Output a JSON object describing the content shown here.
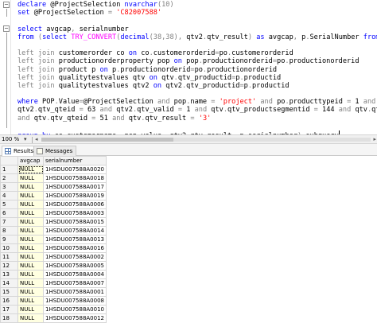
{
  "editor": {
    "lines": [
      [
        {
          "t": "declare ",
          "c": "kw"
        },
        {
          "t": "@ProjectSelection ",
          "c": "vr"
        },
        {
          "t": "nvarchar",
          "c": "kw"
        },
        {
          "t": "(10)",
          "c": "op"
        }
      ],
      [
        {
          "t": "set ",
          "c": "kw"
        },
        {
          "t": "@ProjectSelection ",
          "c": "vr"
        },
        {
          "t": "= ",
          "c": "op"
        },
        {
          "t": "'C82007588'",
          "c": "str"
        }
      ],
      [],
      [
        {
          "t": "select ",
          "c": "kw"
        },
        {
          "t": "avgcap",
          "c": "vr"
        },
        {
          "t": ", ",
          "c": "op"
        },
        {
          "t": "serialnumber",
          "c": "vr"
        }
      ],
      [
        {
          "t": "from ",
          "c": "kw"
        },
        {
          "t": "(",
          "c": "op"
        },
        {
          "t": "select ",
          "c": "kw"
        },
        {
          "t": "TRY_CONVERT",
          "c": "fn"
        },
        {
          "t": "(",
          "c": "op"
        },
        {
          "t": "decimal",
          "c": "kw"
        },
        {
          "t": "(38,38), ",
          "c": "op"
        },
        {
          "t": "qtv2",
          "c": "vr"
        },
        {
          "t": ".",
          "c": "op"
        },
        {
          "t": "qtv_result",
          "c": "vr"
        },
        {
          "t": ") ",
          "c": "op"
        },
        {
          "t": "as ",
          "c": "kw"
        },
        {
          "t": "avgcap",
          "c": "vr"
        },
        {
          "t": ", ",
          "c": "op"
        },
        {
          "t": "p",
          "c": "vr"
        },
        {
          "t": ".",
          "c": "op"
        },
        {
          "t": "SerialNumber ",
          "c": "vr"
        },
        {
          "t": "from ",
          "c": "kw"
        },
        {
          "t": "ProductionOrder PO",
          "c": "vr"
        }
      ],
      [],
      [
        {
          "t": "left join ",
          "c": "op"
        },
        {
          "t": "customerorder co ",
          "c": "vr"
        },
        {
          "t": "on ",
          "c": "kw"
        },
        {
          "t": "co",
          "c": "vr"
        },
        {
          "t": ".",
          "c": "op"
        },
        {
          "t": "customerorderid",
          "c": "vr"
        },
        {
          "t": "=",
          "c": "op"
        },
        {
          "t": "po",
          "c": "vr"
        },
        {
          "t": ".",
          "c": "op"
        },
        {
          "t": "customerorderid",
          "c": "vr"
        }
      ],
      [
        {
          "t": "left join ",
          "c": "op"
        },
        {
          "t": "productionorderproperty pop ",
          "c": "vr"
        },
        {
          "t": "on ",
          "c": "kw"
        },
        {
          "t": "pop",
          "c": "vr"
        },
        {
          "t": ".",
          "c": "op"
        },
        {
          "t": "productionorderid",
          "c": "vr"
        },
        {
          "t": "=",
          "c": "op"
        },
        {
          "t": "po",
          "c": "vr"
        },
        {
          "t": ".",
          "c": "op"
        },
        {
          "t": "productionorderid",
          "c": "vr"
        }
      ],
      [
        {
          "t": "left join ",
          "c": "op"
        },
        {
          "t": "product p ",
          "c": "vr"
        },
        {
          "t": "on ",
          "c": "kw"
        },
        {
          "t": "p",
          "c": "vr"
        },
        {
          "t": ".",
          "c": "op"
        },
        {
          "t": "productionorderid",
          "c": "vr"
        },
        {
          "t": "=",
          "c": "op"
        },
        {
          "t": "po",
          "c": "vr"
        },
        {
          "t": ".",
          "c": "op"
        },
        {
          "t": "productionorderid",
          "c": "vr"
        }
      ],
      [
        {
          "t": "left join ",
          "c": "op"
        },
        {
          "t": "qualitytestvalues qtv ",
          "c": "vr"
        },
        {
          "t": "on ",
          "c": "kw"
        },
        {
          "t": "qtv",
          "c": "vr"
        },
        {
          "t": ".",
          "c": "op"
        },
        {
          "t": "qtv_productid",
          "c": "vr"
        },
        {
          "t": "=",
          "c": "op"
        },
        {
          "t": "p",
          "c": "vr"
        },
        {
          "t": ".",
          "c": "op"
        },
        {
          "t": "productid",
          "c": "vr"
        }
      ],
      [
        {
          "t": "left join ",
          "c": "op"
        },
        {
          "t": "qualitytestvalues qtv2 ",
          "c": "vr"
        },
        {
          "t": "on ",
          "c": "kw"
        },
        {
          "t": "qtv2",
          "c": "vr"
        },
        {
          "t": ".",
          "c": "op"
        },
        {
          "t": "qtv_productid",
          "c": "vr"
        },
        {
          "t": "=",
          "c": "op"
        },
        {
          "t": "p",
          "c": "vr"
        },
        {
          "t": ".",
          "c": "op"
        },
        {
          "t": "productid",
          "c": "vr"
        }
      ],
      [],
      [
        {
          "t": "where ",
          "c": "kw"
        },
        {
          "t": "POP",
          "c": "vr"
        },
        {
          "t": ".",
          "c": "op"
        },
        {
          "t": "Value",
          "c": "vr"
        },
        {
          "t": "=",
          "c": "op"
        },
        {
          "t": "@ProjectSelection ",
          "c": "vr"
        },
        {
          "t": "and ",
          "c": "op"
        },
        {
          "t": "pop",
          "c": "vr"
        },
        {
          "t": ".",
          "c": "op"
        },
        {
          "t": "name ",
          "c": "vr"
        },
        {
          "t": "= ",
          "c": "op"
        },
        {
          "t": "'project' ",
          "c": "str"
        },
        {
          "t": "and ",
          "c": "op"
        },
        {
          "t": "po",
          "c": "vr"
        },
        {
          "t": ".",
          "c": "op"
        },
        {
          "t": "producttypeid ",
          "c": "vr"
        },
        {
          "t": "= ",
          "c": "op"
        },
        {
          "t": "1 ",
          "c": "vr"
        },
        {
          "t": "and",
          "c": "op"
        }
      ],
      [
        {
          "t": "qtv2",
          "c": "vr"
        },
        {
          "t": ".",
          "c": "op"
        },
        {
          "t": "qtv_qteid ",
          "c": "vr"
        },
        {
          "t": "= ",
          "c": "op"
        },
        {
          "t": "63 ",
          "c": "vr"
        },
        {
          "t": "and ",
          "c": "op"
        },
        {
          "t": "qtv2",
          "c": "vr"
        },
        {
          "t": ".",
          "c": "op"
        },
        {
          "t": "qtv_valid ",
          "c": "vr"
        },
        {
          "t": "= ",
          "c": "op"
        },
        {
          "t": "1 ",
          "c": "vr"
        },
        {
          "t": "and ",
          "c": "op"
        },
        {
          "t": "qtv",
          "c": "vr"
        },
        {
          "t": ".",
          "c": "op"
        },
        {
          "t": "qtv_productsegmentid ",
          "c": "vr"
        },
        {
          "t": "= ",
          "c": "op"
        },
        {
          "t": "144 ",
          "c": "vr"
        },
        {
          "t": "and ",
          "c": "op"
        },
        {
          "t": "qtv",
          "c": "vr"
        },
        {
          "t": ".",
          "c": "op"
        },
        {
          "t": "qtv_valid ",
          "c": "vr"
        },
        {
          "t": "= ",
          "c": "op"
        },
        {
          "t": "1",
          "c": "vr"
        }
      ],
      [
        {
          "t": "and ",
          "c": "op"
        },
        {
          "t": "qtv",
          "c": "vr"
        },
        {
          "t": ".",
          "c": "op"
        },
        {
          "t": "qtv_qteid ",
          "c": "vr"
        },
        {
          "t": "= ",
          "c": "op"
        },
        {
          "t": "51 ",
          "c": "vr"
        },
        {
          "t": "and ",
          "c": "op"
        },
        {
          "t": "qtv",
          "c": "vr"
        },
        {
          "t": ".",
          "c": "op"
        },
        {
          "t": "qtv_result ",
          "c": "vr"
        },
        {
          "t": "= ",
          "c": "op"
        },
        {
          "t": "'3'",
          "c": "str"
        }
      ],
      [],
      [
        {
          "t": "group by ",
          "c": "kw"
        },
        {
          "t": "co",
          "c": "vr"
        },
        {
          "t": ".",
          "c": "op"
        },
        {
          "t": "customername",
          "c": "vr"
        },
        {
          "t": ", ",
          "c": "op"
        },
        {
          "t": "pop",
          "c": "vr"
        },
        {
          "t": ".",
          "c": "op"
        },
        {
          "t": "value",
          "c": "vr"
        },
        {
          "t": ", ",
          "c": "op"
        },
        {
          "t": "qtv2",
          "c": "vr"
        },
        {
          "t": ".",
          "c": "op"
        },
        {
          "t": "qtv_result",
          "c": "vr"
        },
        {
          "t": ", ",
          "c": "op"
        },
        {
          "t": "p",
          "c": "vr"
        },
        {
          "t": ".",
          "c": "op"
        },
        {
          "t": "serialnumber",
          "c": "vr"
        },
        {
          "t": ") ",
          "c": "op"
        },
        {
          "t": "subquery",
          "c": "vr"
        }
      ]
    ],
    "colors": {
      "kw": "#0000ff",
      "fn": "#ff00ff",
      "str": "#ff0000",
      "op": "#808080",
      "vr": "#000000"
    }
  },
  "zoom": {
    "value": "100 %",
    "arrow": "▾"
  },
  "tabs": [
    {
      "label": "Results",
      "icon": "grid-icon",
      "active": true
    },
    {
      "label": "Messages",
      "icon": "message-icon",
      "active": false
    }
  ],
  "results": {
    "columns": [
      "avgcap",
      "serialnumber"
    ],
    "rows": [
      [
        "1",
        "NULL",
        "1HSDU007588A0020"
      ],
      [
        "2",
        "NULL",
        "1HSDU007588A0018"
      ],
      [
        "3",
        "NULL",
        "1HSDU007588A0017"
      ],
      [
        "4",
        "NULL",
        "1HSDU007588A0019"
      ],
      [
        "5",
        "NULL",
        "1HSDU007588A0006"
      ],
      [
        "6",
        "NULL",
        "1HSDU007588A0003"
      ],
      [
        "7",
        "NULL",
        "1HSDU007588A0015"
      ],
      [
        "8",
        "NULL",
        "1HSDU007588A0014"
      ],
      [
        "9",
        "NULL",
        "1HSDU007588A0013"
      ],
      [
        "10",
        "NULL",
        "1HSDU007588A0016"
      ],
      [
        "11",
        "NULL",
        "1HSDU007588A0002"
      ],
      [
        "12",
        "NULL",
        "1HSDU007588A0005"
      ],
      [
        "13",
        "NULL",
        "1HSDU007588A0004"
      ],
      [
        "14",
        "NULL",
        "1HSDU007588A0007"
      ],
      [
        "15",
        "NULL",
        "1HSDU007588A0001"
      ],
      [
        "16",
        "NULL",
        "1HSDU007588A0008"
      ],
      [
        "17",
        "NULL",
        "1HSDU007588A0010"
      ],
      [
        "18",
        "NULL",
        "1HSDU007588A0012"
      ]
    ]
  }
}
